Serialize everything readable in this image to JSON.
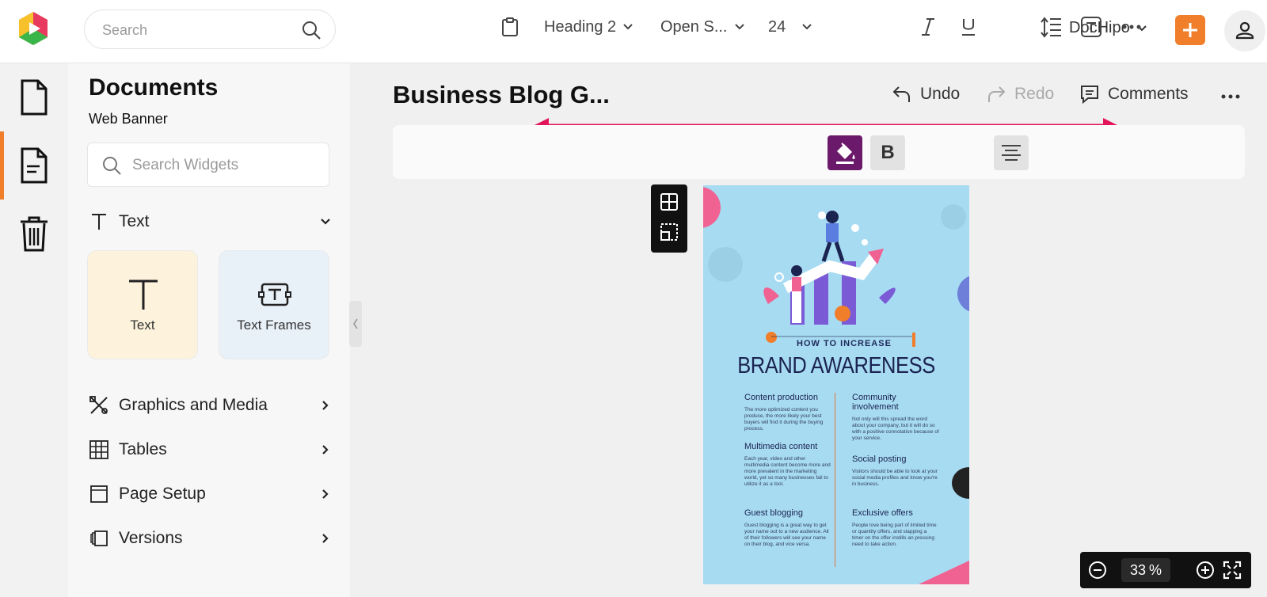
{
  "header": {
    "search_placeholder": "Search",
    "workspace_label": "DocHipo",
    "accent_color": "#f07e2b"
  },
  "rail": {
    "items": [
      "file-icon",
      "document-icon",
      "trash-icon"
    ],
    "active_index": 1
  },
  "panel": {
    "title": "Documents",
    "subtitle": "Web Banner",
    "search_placeholder": "Search Widgets",
    "text_section": "Text",
    "cards": [
      {
        "label": "Text"
      },
      {
        "label": "Text Frames"
      }
    ],
    "sections": [
      {
        "label": "Graphics and Media",
        "icon": "graphics-icon"
      },
      {
        "label": "Tables",
        "icon": "table-icon"
      },
      {
        "label": "Page Setup",
        "icon": "page-setup-icon"
      },
      {
        "label": "Versions",
        "icon": "versions-icon"
      }
    ]
  },
  "editor": {
    "doc_title": "Business Blog G...",
    "undo_label": "Undo",
    "redo_label": "Redo",
    "comments_label": "Comments"
  },
  "toolbar": {
    "style": "Heading 2",
    "font": "Open S...",
    "size": "24",
    "fill_color": "#6b1a6b"
  },
  "page": {
    "kicker": "HOW TO INCREASE",
    "title": "BRAND AWARENESS",
    "bg_color": "#a7dbf2",
    "left_col": [
      {
        "heading": "Content production",
        "body": "The more optimized content you produce, the more likely your best buyers will find it during the buying process."
      },
      {
        "heading": "Multimedia content",
        "body": "Each year, video and other multimedia content become more and more prevalent in the marketing world, yet so many businesses fail to utilize it as a tool."
      },
      {
        "heading": "Guest blogging",
        "body": "Guest blogging is a great way to get your name out to a new audience. All of their followers will see your name on their blog, and vice versa."
      }
    ],
    "right_col": [
      {
        "heading": "Community involvement",
        "body": "Not only will this spread the word about your company, but it will do so with a positive connotation because of your service."
      },
      {
        "heading": "Social posting",
        "body": "Visitors should be able to look at your social media profiles and know you're in business."
      },
      {
        "heading": "Exclusive offers",
        "body": "People love being part of limited time or quantity offers, and slapping a timer on the offer instills an pressing need to take action."
      }
    ]
  },
  "zoom": {
    "value": "33",
    "unit": "%"
  }
}
